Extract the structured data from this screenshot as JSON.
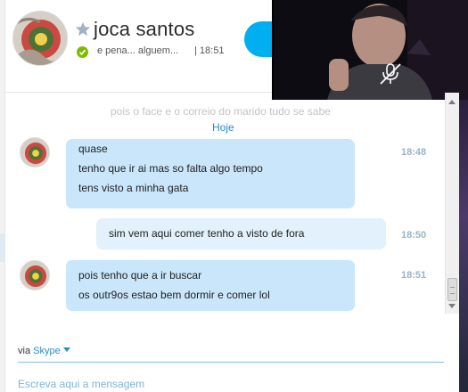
{
  "contact": {
    "name": "joca santos",
    "mood": "e pena... alguem...",
    "last_seen": "| 18:51",
    "avatar_icon": "profile-photo-icon",
    "favorite_icon": "star-icon",
    "status_icon": "online-check-icon"
  },
  "video": {
    "mic_icon": "microphone-muted-icon"
  },
  "conversation": {
    "faded_preview": "pois o face e o correio do marido tudo se sabe",
    "day_label": "Hoje",
    "messages": [
      {
        "direction": "received",
        "time": "18:48",
        "lines": [
          "quase",
          "tenho que ir ai mas so falta algo tempo",
          "tens visto a minha gata"
        ]
      },
      {
        "direction": "sent",
        "time": "18:50",
        "lines": [
          "sim  vem aqui comer tenho a visto de fora"
        ]
      },
      {
        "direction": "received",
        "time": "18:51",
        "lines": [
          "pois tenho que a ir buscar",
          "os outr9os estao bem dormir e comer lol"
        ]
      }
    ]
  },
  "composer": {
    "via_label": "via",
    "via_service": "Skype",
    "placeholder": "Escreva aqui a mensagem"
  },
  "colors": {
    "accent": "#00aff0",
    "link": "#2a8ccf",
    "bubble_received": "#c9e6fa",
    "bubble_sent": "#e2f1fb",
    "online": "#7fba00"
  }
}
